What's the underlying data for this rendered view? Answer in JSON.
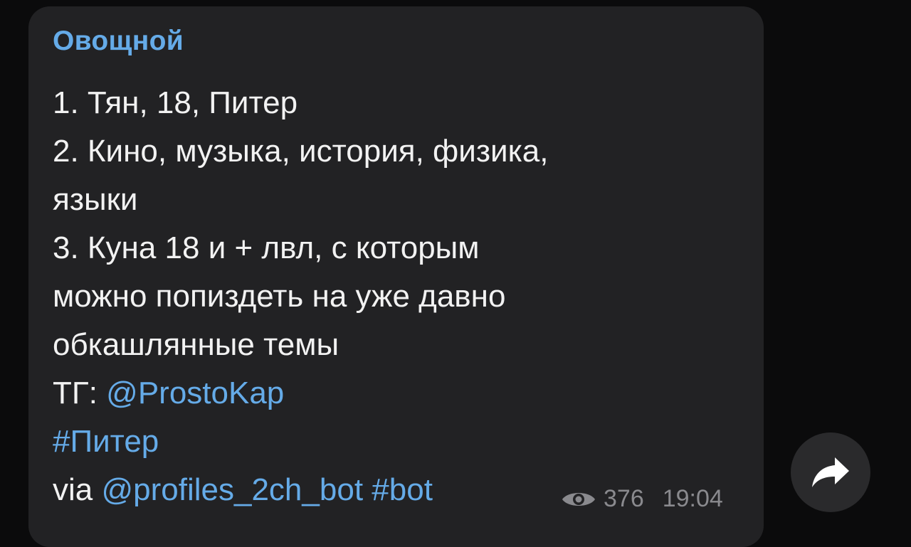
{
  "message": {
    "channel_name": "Овощной",
    "lines": [
      "1. Тян, 18, Питер",
      "2. Кино, музыка, история, физика,",
      "языки",
      "3. Куна 18 и + лвл, с которым",
      "можно попиздеть на уже давно",
      "обкашлянные темы"
    ],
    "tg_prefix": "ТГ: ",
    "tg_link": "@ProstoKap",
    "hashtag": "#Питер",
    "via_prefix": "via ",
    "bot_link": "@profiles_2ch_bot",
    "bot_hashtag": "#bot",
    "views": "376",
    "time": "19:04"
  },
  "icons": {
    "views": "eye-icon",
    "share": "share-arrow-icon"
  },
  "colors": {
    "background": "#0b0b0c",
    "bubble": "#222224",
    "accent": "#65abe8",
    "text": "#f2f2f2",
    "meta": "#8a8a8e"
  }
}
